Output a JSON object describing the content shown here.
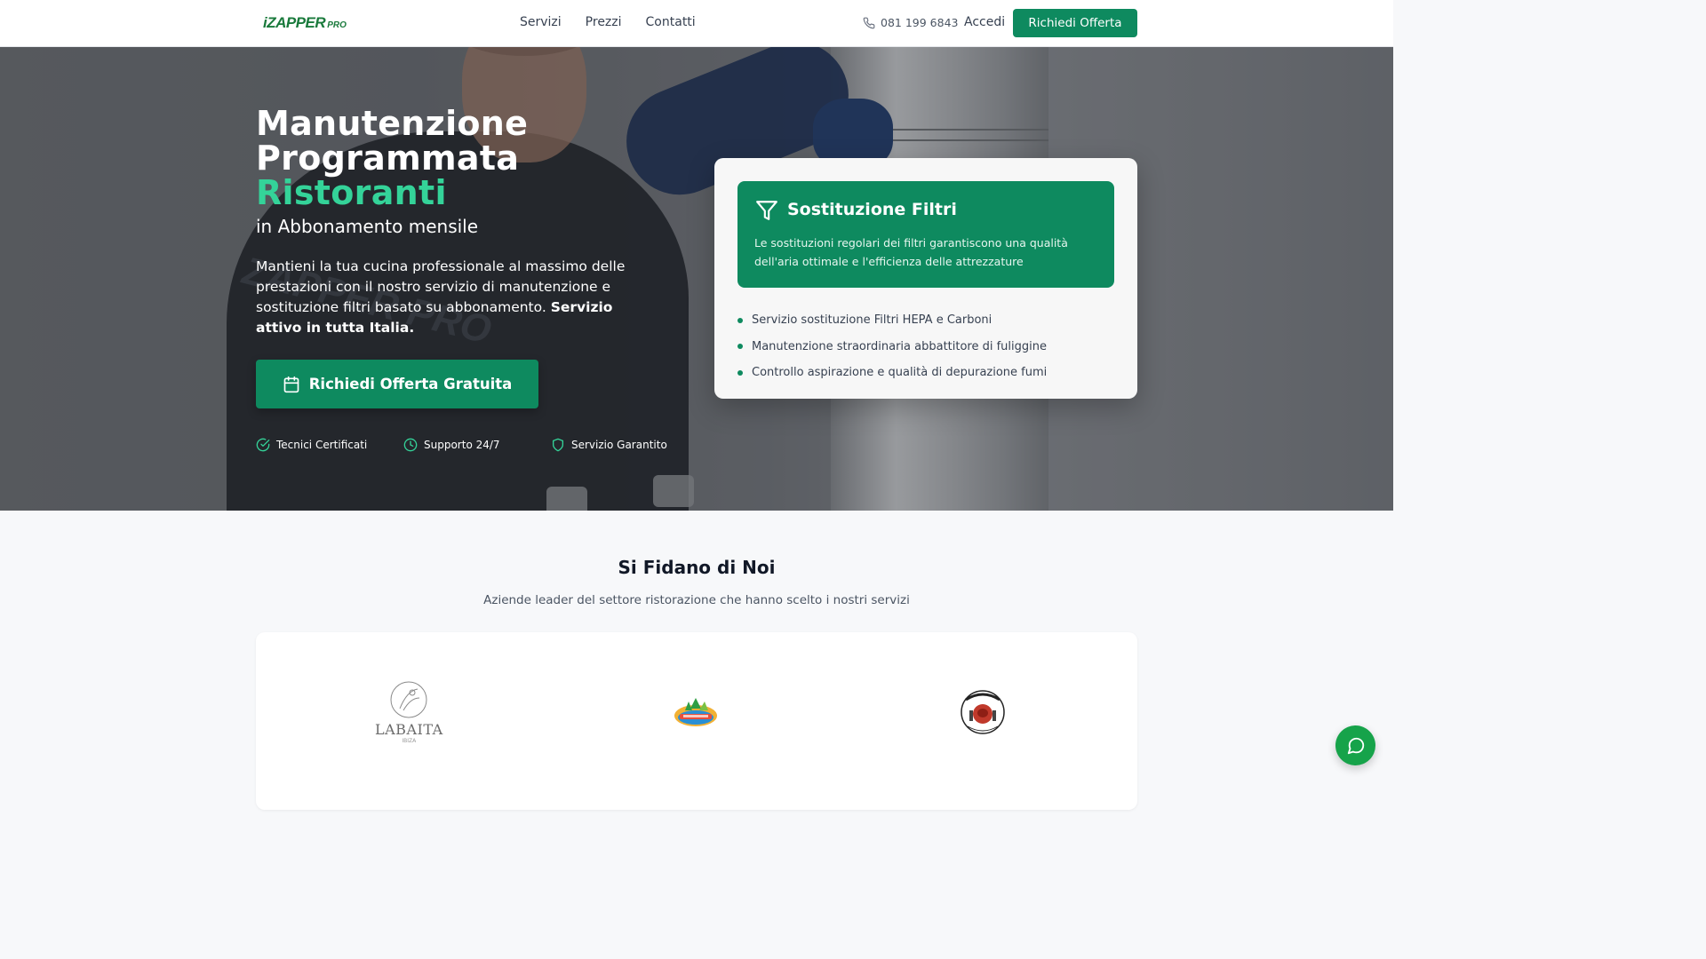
{
  "header": {
    "logo_main": "iZAPPER",
    "logo_sub": "PRO",
    "nav": [
      "Servizi",
      "Prezzi",
      "Contatti"
    ],
    "phone": "081 199 6843",
    "login": "Accedi",
    "cta": "Richiedi Offerta"
  },
  "hero": {
    "title_line1": "Manutenzione",
    "title_line2": "Programmata",
    "title_accent": "Ristoranti",
    "subtitle": "in Abbonamento mensile",
    "description": "Mantieni la tua cucina professionale al massimo delle prestazioni con il nostro servizio di manutenzione e sostituzione filtri basato su abbonamento.",
    "description_bold": "Servizio attivo in tutta Italia.",
    "cta": "Richiedi Offerta Gratuita",
    "badges": [
      "Tecnici Certificati",
      "Supporto 24/7",
      "Servizio Garantito"
    ],
    "shirt_print": "ZAPPER PRO"
  },
  "card": {
    "title": "Sostituzione Filtri",
    "text": "Le sostituzioni regolari dei filtri garantiscono una qualità dell'aria ottimale e l'efficienza delle attrezzature",
    "items": [
      "Servizio sostituzione Filtri HEPA e Carboni",
      "Manutenzione straordinaria abbattitore di fuliggine",
      "Controllo aspirazione e qualità di depurazione fumi"
    ]
  },
  "trust": {
    "title": "Si Fidano di Noi",
    "subtitle": "Aziende leader del settore ristorazione che hanno scelto i nostri servizi",
    "logos": [
      "LA BAITA",
      "Lido logo",
      "Ragusa Matica logo"
    ],
    "baita_text": "LABAITA",
    "baita_small": "IBIZA"
  },
  "colors": {
    "brand_green": "#0e8a5f",
    "accent_green": "#34d399",
    "chat_green": "#16a34a"
  },
  "icons": [
    "phone-icon",
    "calendar-icon",
    "check-circle-icon",
    "clock-icon",
    "shield-icon",
    "filter-icon",
    "chat-icon"
  ]
}
